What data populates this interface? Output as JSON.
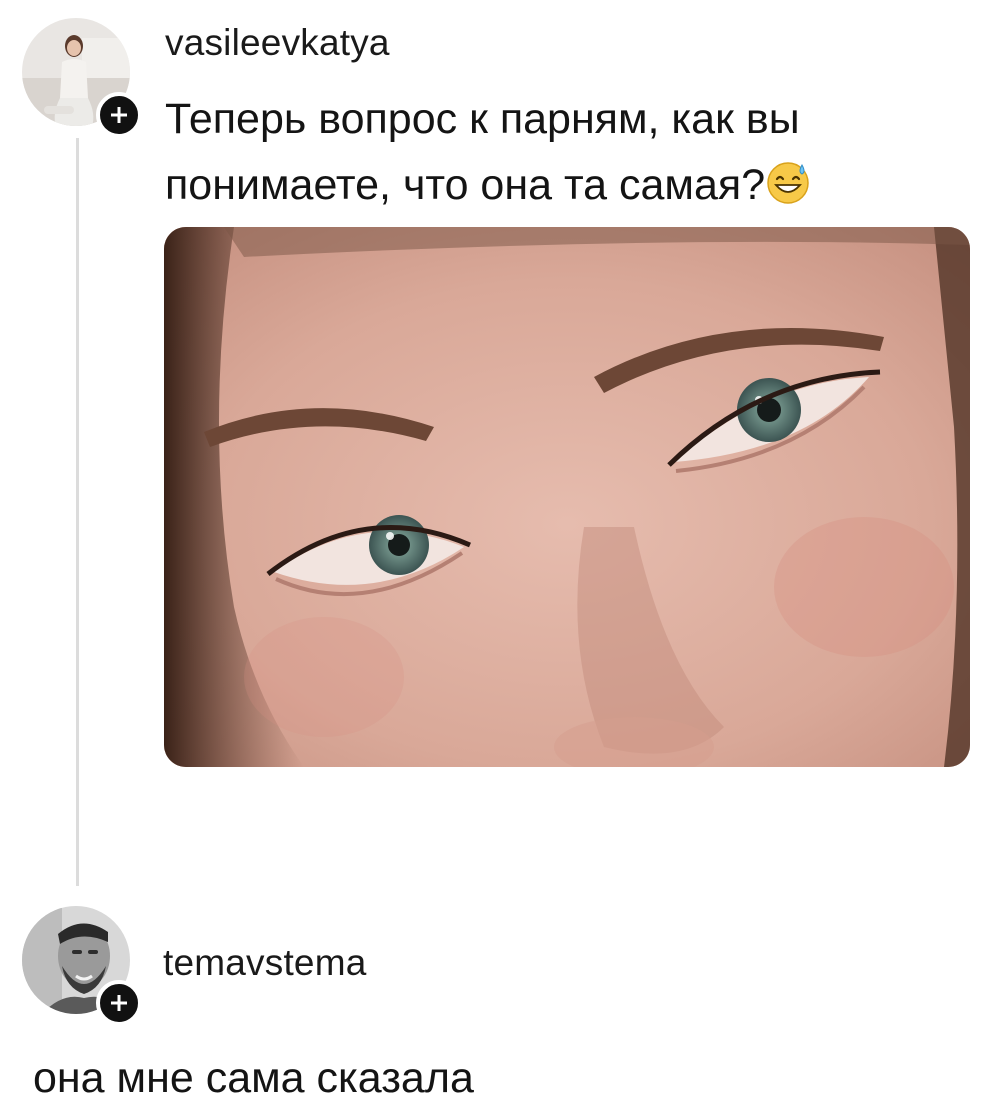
{
  "post": {
    "username": "vasileevkatya",
    "text": "Теперь вопрос к парням, как вы понимаете, что она та самая?",
    "emoji": "grinning-sweat-emoji",
    "avatar_icon": "avatar-woman",
    "follow_icon": "plus-icon"
  },
  "reply": {
    "username": "temavstema",
    "text": "она мне сама сказала",
    "avatar_icon": "avatar-man",
    "follow_icon": "plus-icon"
  },
  "colors": {
    "text": "#141414",
    "thread_line": "#dcdcdc",
    "badge": "#111111"
  }
}
